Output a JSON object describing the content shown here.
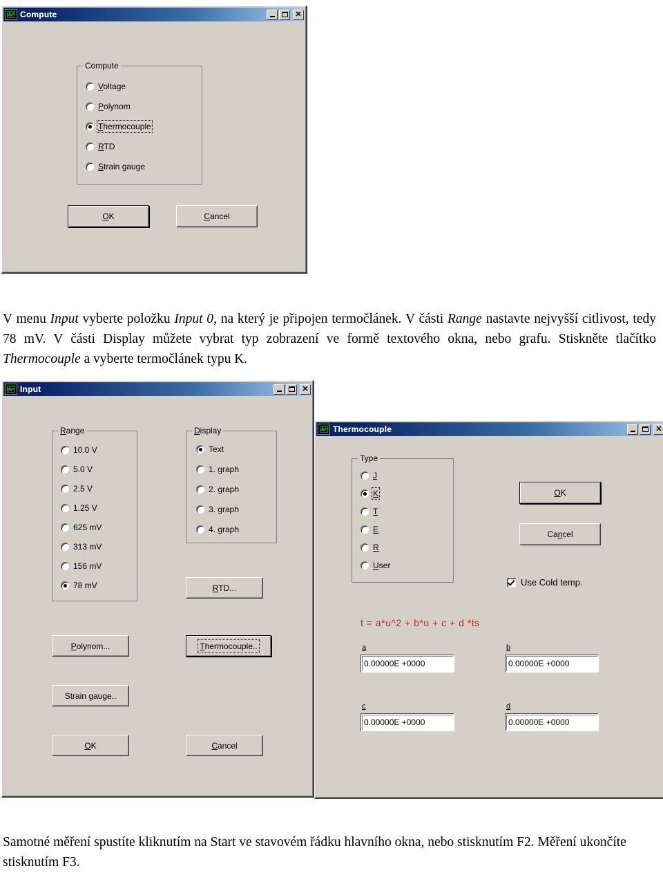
{
  "meta": {
    "accent_titlebar_dark": "#0a246a",
    "accent_titlebar_light": "#a6caf0",
    "dialog_face": "#d4d0c8",
    "formula_color": "#d02020"
  },
  "compute_window": {
    "title": "Compute",
    "icon": "scope-waveform-icon",
    "buttons": {
      "minimize": "_",
      "maximize": "□",
      "close": "✕"
    },
    "group": {
      "title": "Compute",
      "options": [
        {
          "label": "Voltage",
          "selected": false,
          "focused": false
        },
        {
          "label": "Polynom",
          "selected": false,
          "focused": false
        },
        {
          "label": "Thermocouple",
          "selected": true,
          "focused": true
        },
        {
          "label": "RTD",
          "selected": false,
          "focused": false
        },
        {
          "label": "Strain gauge",
          "selected": false,
          "focused": false
        }
      ]
    },
    "ok_label": "OK",
    "cancel_label": "Cancel"
  },
  "paragraph_top": {
    "line1_a": "V menu ",
    "line1_i1": "Input",
    "line1_b": " vyberte položku ",
    "line1_i2": "Input 0",
    "line1_c": ", na který je připojen termočlánek. V části ",
    "line1_i3": "Range",
    "line1_d": " nastavte nejvyšší citlivost, tedy 78 mV. V části Display můžete vybrat typ zobrazení ve formě textového okna, nebo grafu. Stiskněte tlačítko ",
    "line1_i4": "Thermocouple",
    "line1_e": " a vyberte termočlánek typu K."
  },
  "input_window": {
    "title": "Input",
    "icon": "scope-waveform-icon",
    "range_group": {
      "title": "Range",
      "title_accel": "R",
      "title_rest": "ange",
      "options": [
        {
          "label": "10.0 V",
          "selected": false
        },
        {
          "label": "5.0 V",
          "selected": false
        },
        {
          "label": "2.5 V",
          "selected": false
        },
        {
          "label": "1.25 V",
          "selected": false
        },
        {
          "label": "625 mV",
          "selected": false
        },
        {
          "label": "313 mV",
          "selected": false
        },
        {
          "label": "156 mV",
          "selected": false
        },
        {
          "label": "78 mV",
          "selected": true
        }
      ]
    },
    "display_group": {
      "title": "Display",
      "title_accel": "D",
      "title_rest": "isplay",
      "options": [
        {
          "label": "Text",
          "selected": true
        },
        {
          "label": "1. graph",
          "selected": false
        },
        {
          "label": "2. graph",
          "selected": false
        },
        {
          "label": "3. graph",
          "selected": false
        },
        {
          "label": "4. graph",
          "selected": false
        }
      ]
    },
    "rtd_button": "RTD...",
    "polynom_button": "Polynom...",
    "thermocouple_button": "Thermocouple..",
    "strain_gauge_button": "Strain gauge..",
    "ok_label": "OK",
    "cancel_label": "Cancel"
  },
  "thermocouple_window": {
    "title": "Thermocouple",
    "icon": "scope-waveform-icon",
    "type_group": {
      "title": "Type",
      "options": [
        {
          "label": "J",
          "selected": false,
          "focused": false
        },
        {
          "label": "K",
          "selected": true,
          "focused": true
        },
        {
          "label": "T",
          "selected": false,
          "focused": false
        },
        {
          "label": "E",
          "selected": false,
          "focused": false
        },
        {
          "label": "R",
          "selected": false,
          "focused": false
        },
        {
          "label": "User",
          "selected": false,
          "focused": false
        }
      ]
    },
    "ok_label": "OK",
    "cancel_label": "Cancel",
    "cold_temp_label": "Use Cold temp.",
    "cold_temp_checked": true,
    "formula": "t = a*u^2 + b*u + c + d *ts",
    "coefficients": [
      {
        "name": "a",
        "value": "0.00000E +0000"
      },
      {
        "name": "b",
        "value": "0.00000E +0000"
      },
      {
        "name": "c",
        "value": "0.00000E +0000"
      },
      {
        "name": "d",
        "value": "0.00000E +0000"
      }
    ]
  },
  "paragraph_bottom": {
    "text": "Samotné měření spustíte kliknutím na Start ve stavovém řádku hlavního okna, nebo stisknutím F2. Měření ukončíte stisknutím F3."
  }
}
